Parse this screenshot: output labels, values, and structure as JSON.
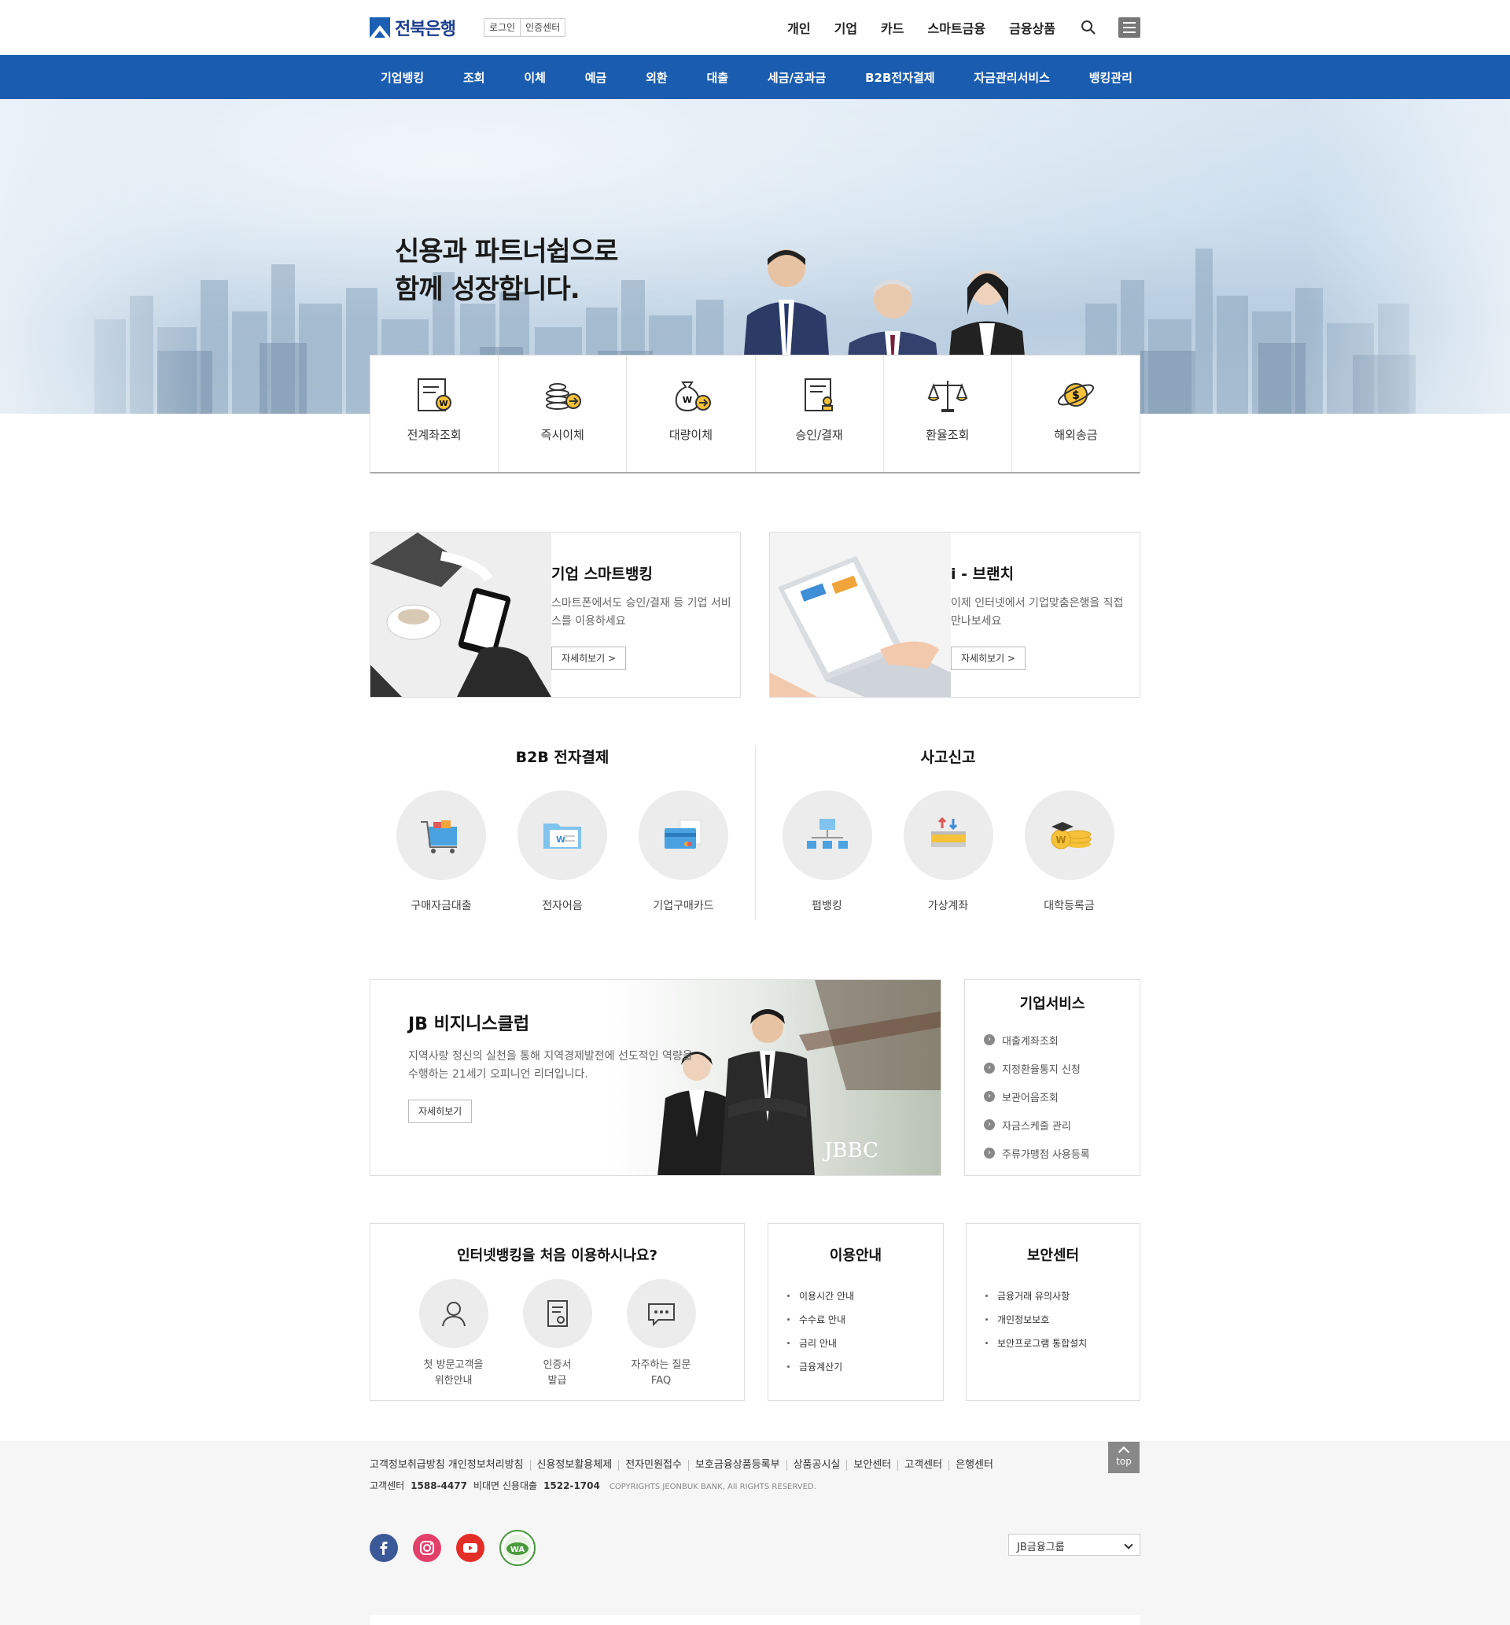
{
  "header": {
    "logo_text": "전북은행",
    "util": [
      "로그인",
      "인증센터"
    ],
    "gnb": [
      "개인",
      "기업",
      "카드",
      "스마트금융",
      "금융상품"
    ],
    "icons": {
      "search": "search-icon",
      "menu": "hamburger-menu-icon"
    }
  },
  "nav": [
    "기업뱅킹",
    "조회",
    "이체",
    "예금",
    "외환",
    "대출",
    "세금/공과금",
    "B2B전자결제",
    "자금관리서비스",
    "뱅킹관리"
  ],
  "hero": {
    "line1": "신용과 파트너쉽으로",
    "line2": "함께 성장합니다."
  },
  "quick_menu": [
    {
      "label": "전계좌조회",
      "icon": "document-won-icon"
    },
    {
      "label": "즉시이체",
      "icon": "coins-arrow-icon"
    },
    {
      "label": "대량이체",
      "icon": "money-bag-arrow-icon"
    },
    {
      "label": "승인/결재",
      "icon": "approval-document-icon"
    },
    {
      "label": "환율조회",
      "icon": "scale-icon"
    },
    {
      "label": "해외송금",
      "icon": "planet-dollar-icon"
    }
  ],
  "cards": [
    {
      "title": "기업 스마트뱅킹",
      "desc": "스마트폰에서도 승인/결재 등 기업 서비스를 이용하세요",
      "button": "자세히보기 >"
    },
    {
      "title": "i - 브랜치",
      "desc": "이제 인터넷에서 기업맞춤은행을 직접 만나보세요",
      "button": "자세히보기 >"
    }
  ],
  "b2b": {
    "title": "B2B 전자결제",
    "items": [
      {
        "label": "구매자금대출",
        "icon": "shopping-cart-icon"
      },
      {
        "label": "전자어음",
        "icon": "folder-won-icon"
      },
      {
        "label": "기업구매카드",
        "icon": "credit-card-icon"
      }
    ]
  },
  "report": {
    "title": "사고신고",
    "items": [
      {
        "label": "펌뱅킹",
        "icon": "network-icon"
      },
      {
        "label": "가상계좌",
        "icon": "transfer-box-icon"
      },
      {
        "label": "대학등록금",
        "icon": "graduation-coins-icon"
      }
    ]
  },
  "club": {
    "title": "JB 비지니스클럽",
    "desc": "지역사랑 정신의 실천을 통해 지역경제발전에 선도적인 역량을 수행하는 21세기 오피니언 리더입니다.",
    "button": "자세히보기",
    "photo_caption": "JBBC"
  },
  "biz_services": {
    "title": "기업서비스",
    "items": [
      "대출계좌조회",
      "지정환율통지 신청",
      "보관어음조회",
      "자금스케줄 관리",
      "주류가맹점 사용등록"
    ]
  },
  "first_use": {
    "title": "인터넷뱅킹을 처음 이용하시나요?",
    "items": [
      {
        "line1": "첫 방문고객을",
        "line2": "위한안내",
        "icon": "user-icon"
      },
      {
        "line1": "인증서",
        "line2": "발급",
        "icon": "certificate-icon"
      },
      {
        "line1": "자주하는 질문",
        "line2": "FAQ",
        "icon": "chat-bubble-icon"
      }
    ]
  },
  "guide": {
    "title": "이용안내",
    "items": [
      "이용시간 안내",
      "수수료 안내",
      "금리 안내",
      "금융계산기"
    ]
  },
  "security": {
    "title": "보안센터",
    "items": [
      "금융거래 유의사항",
      "개인정보보호",
      "보안프로그램 통합설치"
    ]
  },
  "footer": {
    "links": [
      "고객정보취급방침 개인정보처리방침",
      "신용정보활용체제",
      "전자민원접수",
      "보호금융상품등록부",
      "상품공시실",
      "보안센터",
      "고객센터",
      "은행센터"
    ],
    "contact_label1": "고객센터",
    "contact_num1": "1588-4477",
    "contact_label2": "비대면 신용대출",
    "contact_num2": "1522-1704",
    "copyright": "COPYRIGHTS JEONBUK BANK, All RIGHTS RESERVED.",
    "top": "top",
    "family_select": "JB금융그룹",
    "wa_mark": "WA",
    "social": [
      "facebook-icon",
      "instagram-icon",
      "youtube-icon",
      "wa-certification-icon"
    ]
  },
  "colors": {
    "brand_blue": "#1a5db0",
    "accent_yellow": "#f5c23a"
  }
}
